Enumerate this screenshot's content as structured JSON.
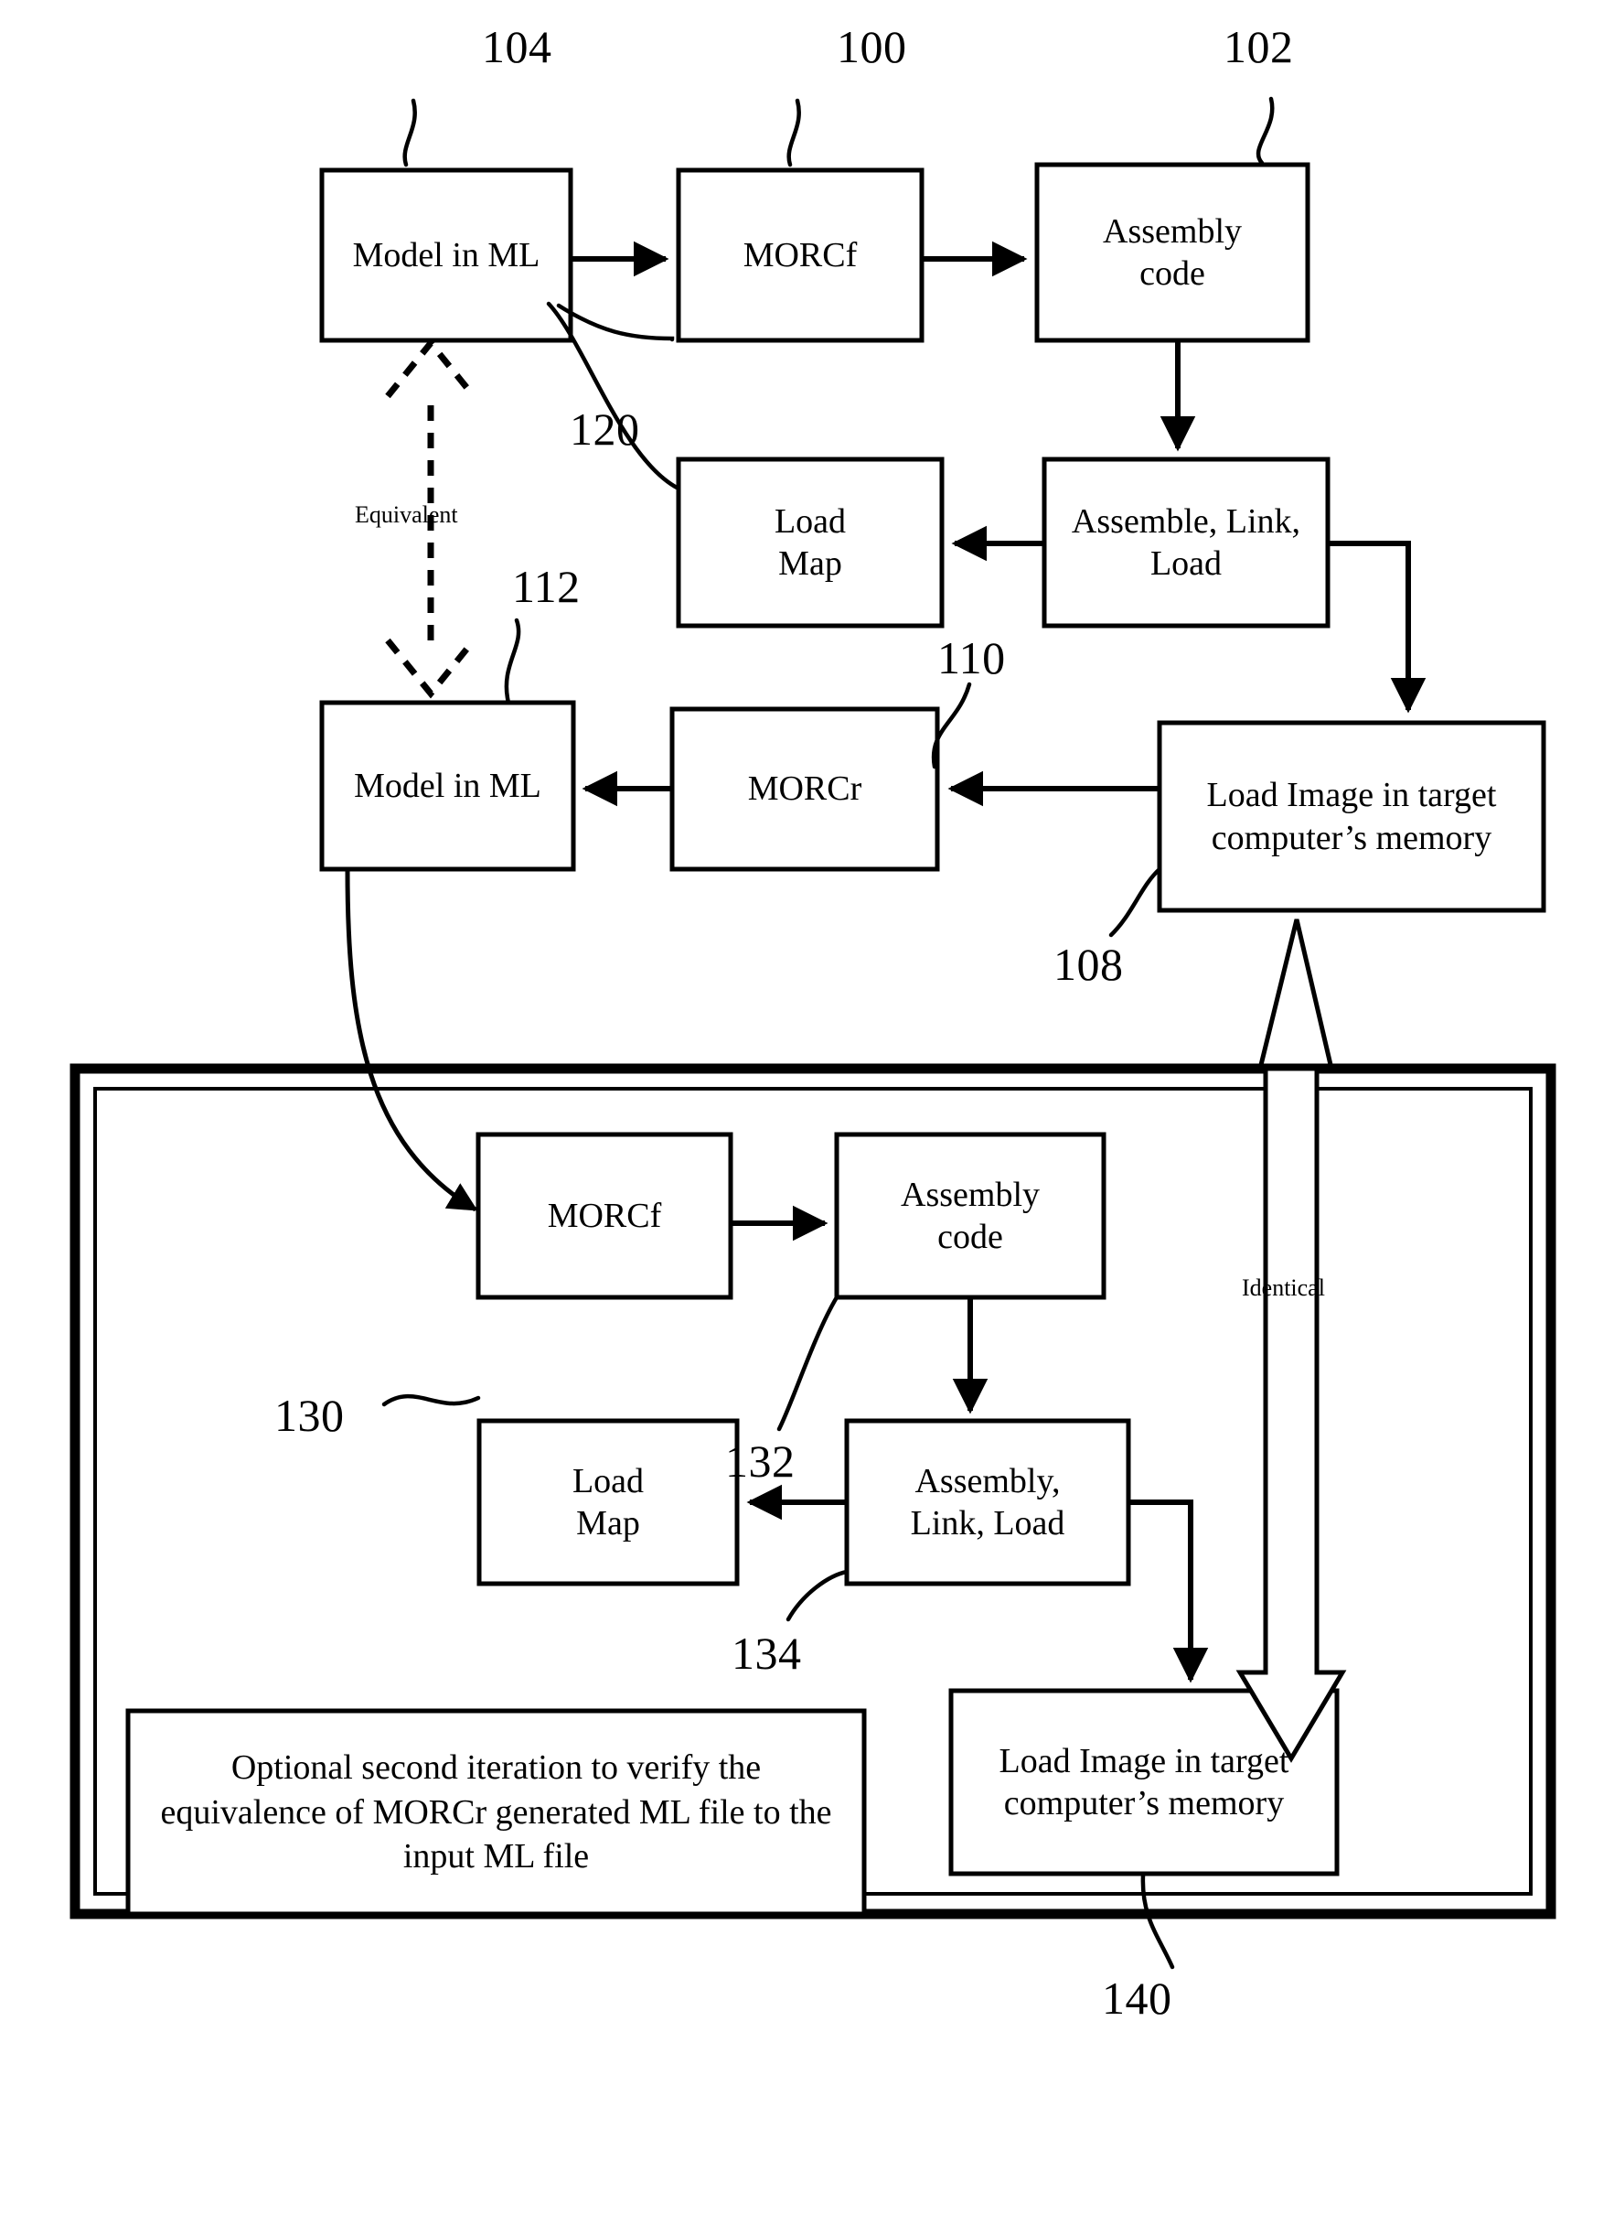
{
  "figure": {
    "type": "patent-flowchart",
    "title": "MORC forward/reverse compilation verification flow"
  },
  "boxes": {
    "model_in_ml_top": "Model in ML",
    "morcf_top": "MORCf",
    "assembly_code_top": "Assembly code",
    "load_map_top": "Load Map",
    "assemble_link_load_top": "Assemble, Link, Load",
    "load_image_top": "Load Image in target computer’s memory",
    "morcr": "MORCr",
    "model_in_ml_mid": "Model in ML",
    "morcf_bottom": "MORCf",
    "assembly_code_bottom": "Assembly code",
    "load_map_bottom": "Load Map",
    "assembly_link_load_bottom": "Assembly, Link, Load",
    "load_image_bottom": "Load Image in target computer’s memory",
    "optional_note": "Optional second iteration to verify the equivalence of MORCr generated ML file to the input ML file"
  },
  "reference_numbers": {
    "n104": "104",
    "n100": "100",
    "n102": "102",
    "n120": "120",
    "n112": "112",
    "n110": "110",
    "n108": "108",
    "n130": "130",
    "n132": "132",
    "n134": "134",
    "n140": "140"
  },
  "annotations": {
    "equivalent": "Equivalent",
    "identical": "Identical"
  },
  "colors": {
    "stroke": "#000000",
    "fill": "#ffffff"
  }
}
